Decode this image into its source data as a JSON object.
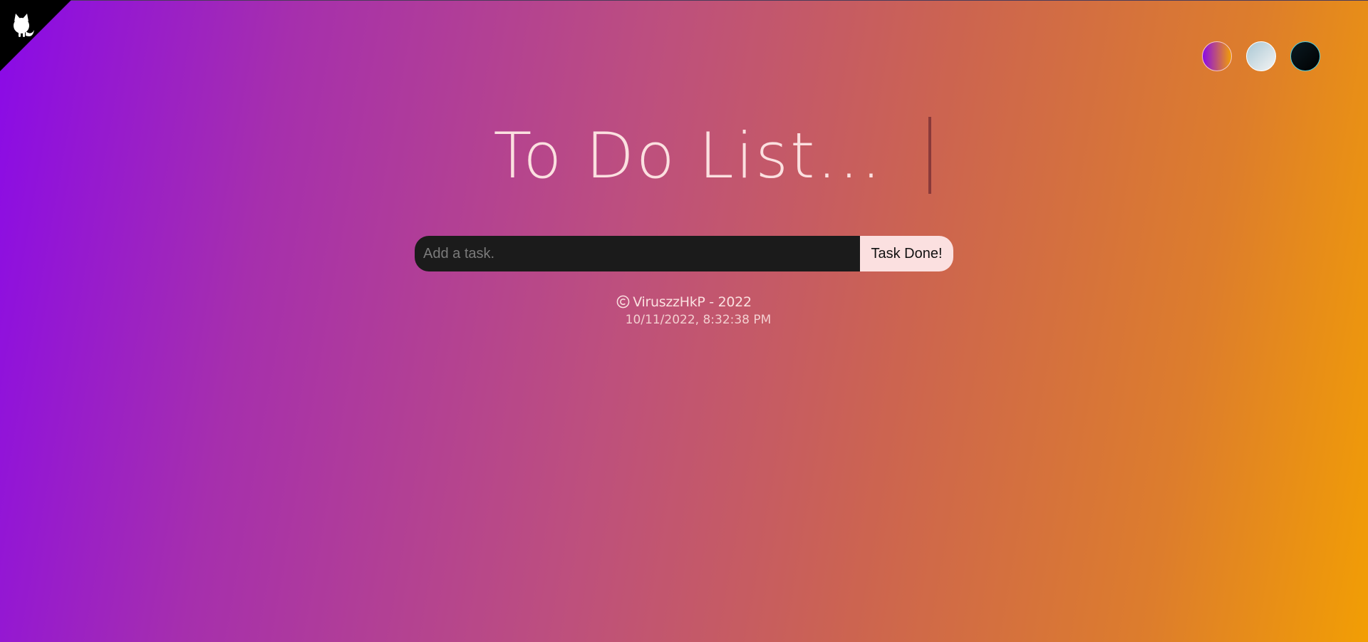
{
  "app": {
    "title": "To Do List..."
  },
  "themes": [
    {
      "name": "gradient-theme",
      "colors": [
        "#8a0ae8",
        "#f29e04"
      ]
    },
    {
      "name": "light-theme",
      "colors": [
        "#a9c7d4",
        "#f4f4f4"
      ]
    },
    {
      "name": "dark-theme",
      "colors": [
        "#0a1a22",
        "#000000"
      ]
    }
  ],
  "form": {
    "placeholder": "Add a task.",
    "value": "",
    "button_label": "Task Done!"
  },
  "footer": {
    "credit": "ViruszzHkP - 2022",
    "datetime": "10/11/2022, 8:32:38 PM"
  },
  "icons": {
    "corner": "github-octocat-icon",
    "copyright": "copyright-icon"
  },
  "colors": {
    "accent": "#fbe0e0",
    "input_bg": "#1b1b1b",
    "gradient_start": "#8a0ae8",
    "gradient_end": "#f29e04"
  }
}
